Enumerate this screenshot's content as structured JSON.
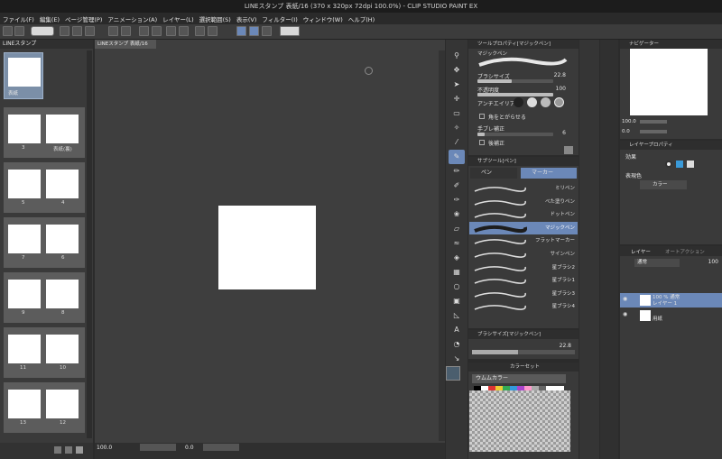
{
  "window": {
    "title": "LINEスタンプ 表紙/16 (370 x 320px 72dpi 100.0%)  - CLIP STUDIO PAINT EX"
  },
  "menu": [
    "ファイル(F)",
    "編集(E)",
    "ページ管理(P)",
    "アニメーション(A)",
    "レイヤー(L)",
    "選択範囲(S)",
    "表示(V)",
    "フィルター(I)",
    "ウィンドウ(W)",
    "ヘルプ(H)"
  ],
  "pages": {
    "panel_title": "LINEスタンプ",
    "cover_label": "表紙",
    "rows": [
      {
        "left": "3",
        "right": "表紙(裏)"
      },
      {
        "left": "5",
        "right": "4"
      },
      {
        "left": "7",
        "right": "6"
      },
      {
        "left": "9",
        "right": "8"
      },
      {
        "left": "11",
        "right": "10"
      },
      {
        "left": "13",
        "right": "12"
      }
    ]
  },
  "canvas": {
    "tab_label": "LINEスタンプ 表紙/16",
    "zoom": "100.0",
    "angle": "0.0"
  },
  "tool_property": {
    "header": "ツールプロパティ[マジックペン]",
    "brush_name": "マジックペン",
    "brush_size_label": "ブラシサイズ",
    "brush_size_value": "22.8",
    "brush_size_fraction": 0.45,
    "opacity_label": "不透明度",
    "opacity_value": "100",
    "opacity_fraction": 1.0,
    "antialias_label": "アンチエイリアス",
    "sharpen_label": "角をとがらせる",
    "stabilize_label": "手ブレ補正",
    "stabilize_value": "6",
    "stabilize_fraction": 0.1,
    "postcorrect_label": "後補正"
  },
  "sub_tool": {
    "header": "サブツール[ペン]",
    "tabs": [
      "ペン",
      "マーカー"
    ],
    "items": [
      {
        "name": "ミリペン",
        "selected": false
      },
      {
        "name": "べた塗りペン",
        "selected": false
      },
      {
        "name": "ドットペン",
        "selected": false
      },
      {
        "name": "マジックペン",
        "selected": true
      },
      {
        "name": "フラットマーカー",
        "selected": false
      },
      {
        "name": "サインペン",
        "selected": false
      },
      {
        "name": "星ブラシ2",
        "selected": false
      },
      {
        "name": "星ブラシ1",
        "selected": false
      },
      {
        "name": "星ブラシ3",
        "selected": false
      },
      {
        "name": "星ブラシ4",
        "selected": false
      }
    ]
  },
  "brush_size_panel": {
    "header": "ブラシサイズ[マジックペン]",
    "value": "22.8"
  },
  "color_set": {
    "header": "カラーセット",
    "set_name": "ウムムカラー"
  },
  "navigator": {
    "header": "ナビゲーター",
    "zoom": "100.0",
    "angle": "0.0"
  },
  "layer_property": {
    "header": "レイヤープロパティ",
    "effect_label": "効果",
    "expression_label": "表現色",
    "expression_value": "カラー"
  },
  "layers": {
    "tabs": [
      "レイヤー",
      "オートアクション"
    ],
    "blend_mode": "通常",
    "opacity": "100",
    "rows": [
      {
        "line1": "100 % 通常",
        "line2": "レイヤー 1",
        "selected": true
      },
      {
        "line1": "",
        "line2": "用紙",
        "selected": false
      }
    ]
  },
  "colors": {
    "accent": "#6b88b8",
    "panel": "#3a3a3a",
    "canvas": "#3e3e3e"
  }
}
